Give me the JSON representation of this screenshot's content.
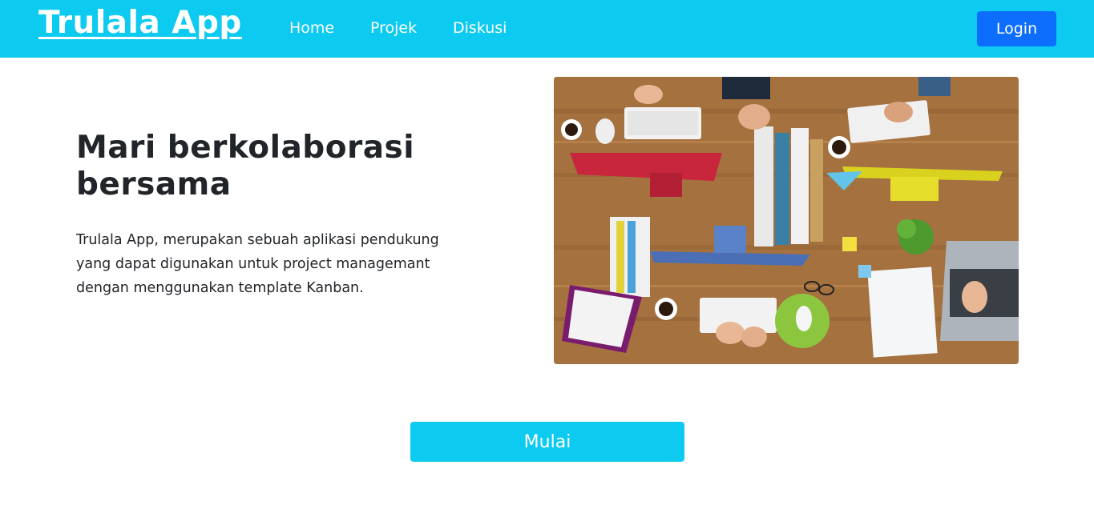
{
  "navbar": {
    "brand": "Trulala App",
    "links": [
      "Home",
      "Projek",
      "Diskusi"
    ],
    "login_label": "Login",
    "background_color": "#0dcaf0",
    "login_color": "#0d6efd"
  },
  "hero": {
    "title": "Mari berkolaborasi bersama",
    "description": "Trulala App, merupakan sebuah aplikasi pendukung yang dapat digunakan untuk project managemant dengan menggunakan template Kanban."
  },
  "cta": {
    "label": "Mulai"
  }
}
